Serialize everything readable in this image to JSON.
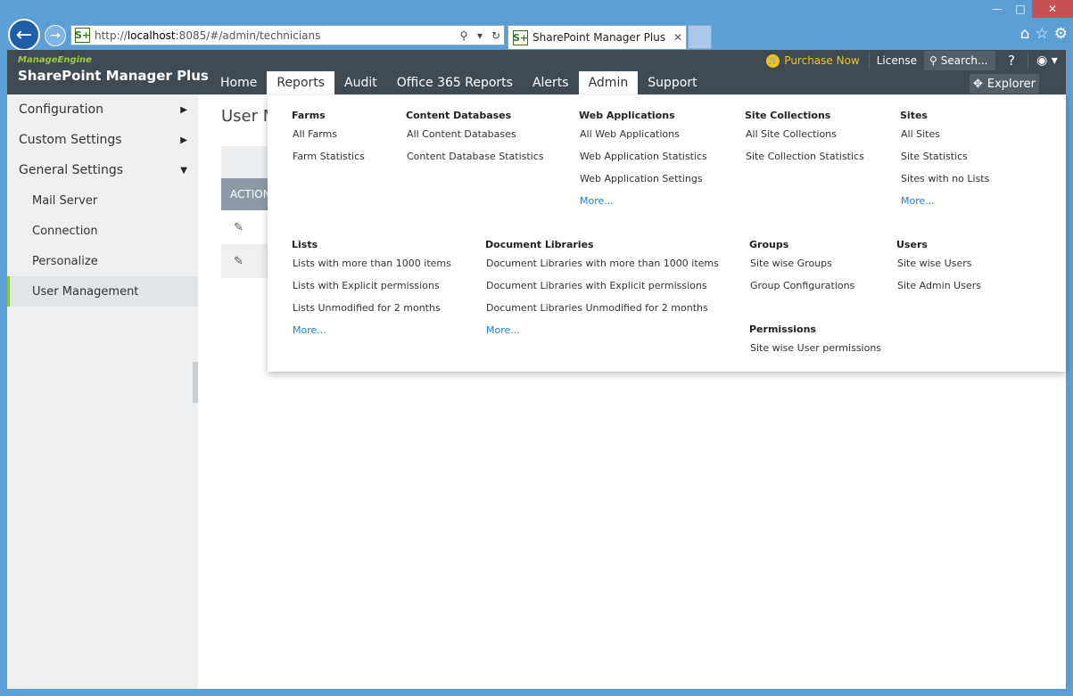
{
  "browser": {
    "url_prefix": "http://",
    "url_host": "localhost",
    "url_rest": ":8085/#/admin/technicians",
    "tab_title": "SharePoint Manager Plus",
    "favicon_text": "S+"
  },
  "header": {
    "brand_small": "ManageEngine",
    "brand_big": "SharePoint Manager Plus",
    "purchase": "Purchase Now",
    "license": "License",
    "search_placeholder": "Search...",
    "help": "?",
    "explorer": "Explorer",
    "nav": [
      "Home",
      "Reports",
      "Audit",
      "Office 365 Reports",
      "Alerts",
      "Admin",
      "Support"
    ]
  },
  "sidebar": {
    "items": [
      {
        "label": "Configuration"
      },
      {
        "label": "Custom Settings"
      },
      {
        "label": "General Settings"
      }
    ],
    "subitems": [
      "Mail Server",
      "Connection",
      "Personalize",
      "User Management"
    ]
  },
  "content": {
    "title": "User M",
    "action_header": "ACTION"
  },
  "menu": {
    "farms": {
      "title": "Farms",
      "links": [
        "All Farms",
        "Farm Statistics"
      ]
    },
    "content_databases": {
      "title": "Content Databases",
      "links": [
        "All Content Databases",
        "Content Database Statistics"
      ]
    },
    "web_applications": {
      "title": "Web Applications",
      "links": [
        "All Web Applications",
        "Web Application Statistics",
        "Web Application Settings"
      ],
      "more": "More..."
    },
    "site_collections": {
      "title": "Site Collections",
      "links": [
        "All Site Collections",
        "Site Collection Statistics"
      ]
    },
    "sites": {
      "title": "Sites",
      "links": [
        "All Sites",
        "Site Statistics",
        "Sites with no Lists"
      ],
      "more": "More..."
    },
    "lists": {
      "title": "Lists",
      "links": [
        "Lists with more than 1000 items",
        "Lists with Explicit permissions",
        "Lists Unmodified for 2 months"
      ],
      "more": "More..."
    },
    "document_libraries": {
      "title": "Document Libraries",
      "links": [
        "Document Libraries with more than 1000 items",
        "Document Libraries with Explicit permissions",
        "Document Libraries Unmodified for 2 months"
      ],
      "more": "More..."
    },
    "groups": {
      "title": "Groups",
      "links": [
        "Site wise Groups",
        "Group Configurations"
      ]
    },
    "permissions": {
      "title": "Permissions",
      "links": [
        "Site wise User permissions"
      ]
    },
    "users": {
      "title": "Users",
      "links": [
        "Site wise Users",
        "Site Admin Users"
      ]
    }
  },
  "colors": {
    "header_bg": "#404a52",
    "accent_green": "#8bc34a",
    "purchase_yellow": "#f3c318",
    "link_blue": "#1a7fd0"
  }
}
